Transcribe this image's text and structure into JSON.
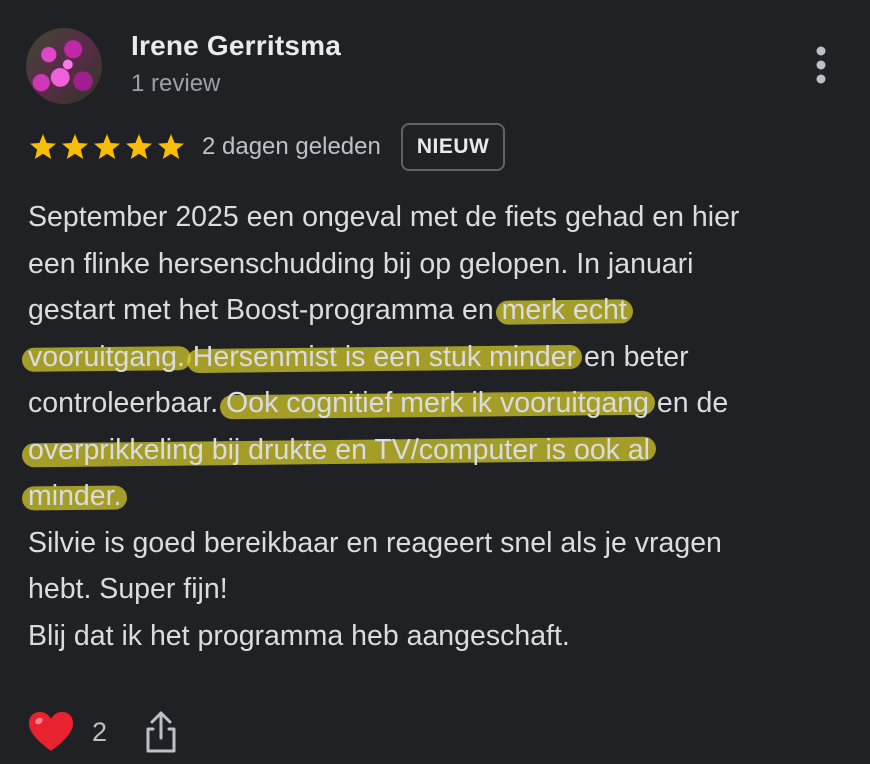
{
  "reviewer": {
    "name": "Irene Gerritsma",
    "review_count": "1 review"
  },
  "rating": {
    "stars": 5,
    "max_stars": 5,
    "date": "2 dagen geleden",
    "badge": "NIEUW",
    "star_color": "#fbbc04"
  },
  "review": {
    "lines": [
      [
        {
          "t": "September 2025 een ongeval met de fiets gehad en hier",
          "hl": false
        }
      ],
      [
        {
          "t": "een flinke hersenschudding bij op gelopen. In januari",
          "hl": false
        }
      ],
      [
        {
          "t": "gestart met het Boost-programma en ",
          "hl": false
        },
        {
          "t": "merk echt",
          "hl": true
        }
      ],
      [
        {
          "t": "vooruitgang.",
          "hl": true
        },
        {
          "t": " ",
          "hl": false
        },
        {
          "t": "Hersenmist is een stuk minder",
          "hl": true
        },
        {
          "t": " en beter",
          "hl": false
        }
      ],
      [
        {
          "t": "controleerbaar. ",
          "hl": false
        },
        {
          "t": "Ook cognitief merk ik vooruitgang",
          "hl": true
        },
        {
          "t": " en de",
          "hl": false
        }
      ],
      [
        {
          "t": "overprikkeling bij drukte en TV/computer is ook al",
          "hl": true
        }
      ],
      [
        {
          "t": "minder.",
          "hl": true
        }
      ],
      [
        {
          "t": "Silvie is goed bereikbaar en reageert snel als je vragen",
          "hl": false
        }
      ],
      [
        {
          "t": "hebt. Super fijn!",
          "hl": false
        }
      ],
      [
        {
          "t": "Blij dat ik het programma heb aangeschaft.",
          "hl": false
        }
      ]
    ],
    "highlight_color": "#d7cd28"
  },
  "actions": {
    "like_icon": "heart-icon",
    "like_count": "2",
    "share_icon": "share-icon",
    "heart_color": "#e8222e"
  }
}
